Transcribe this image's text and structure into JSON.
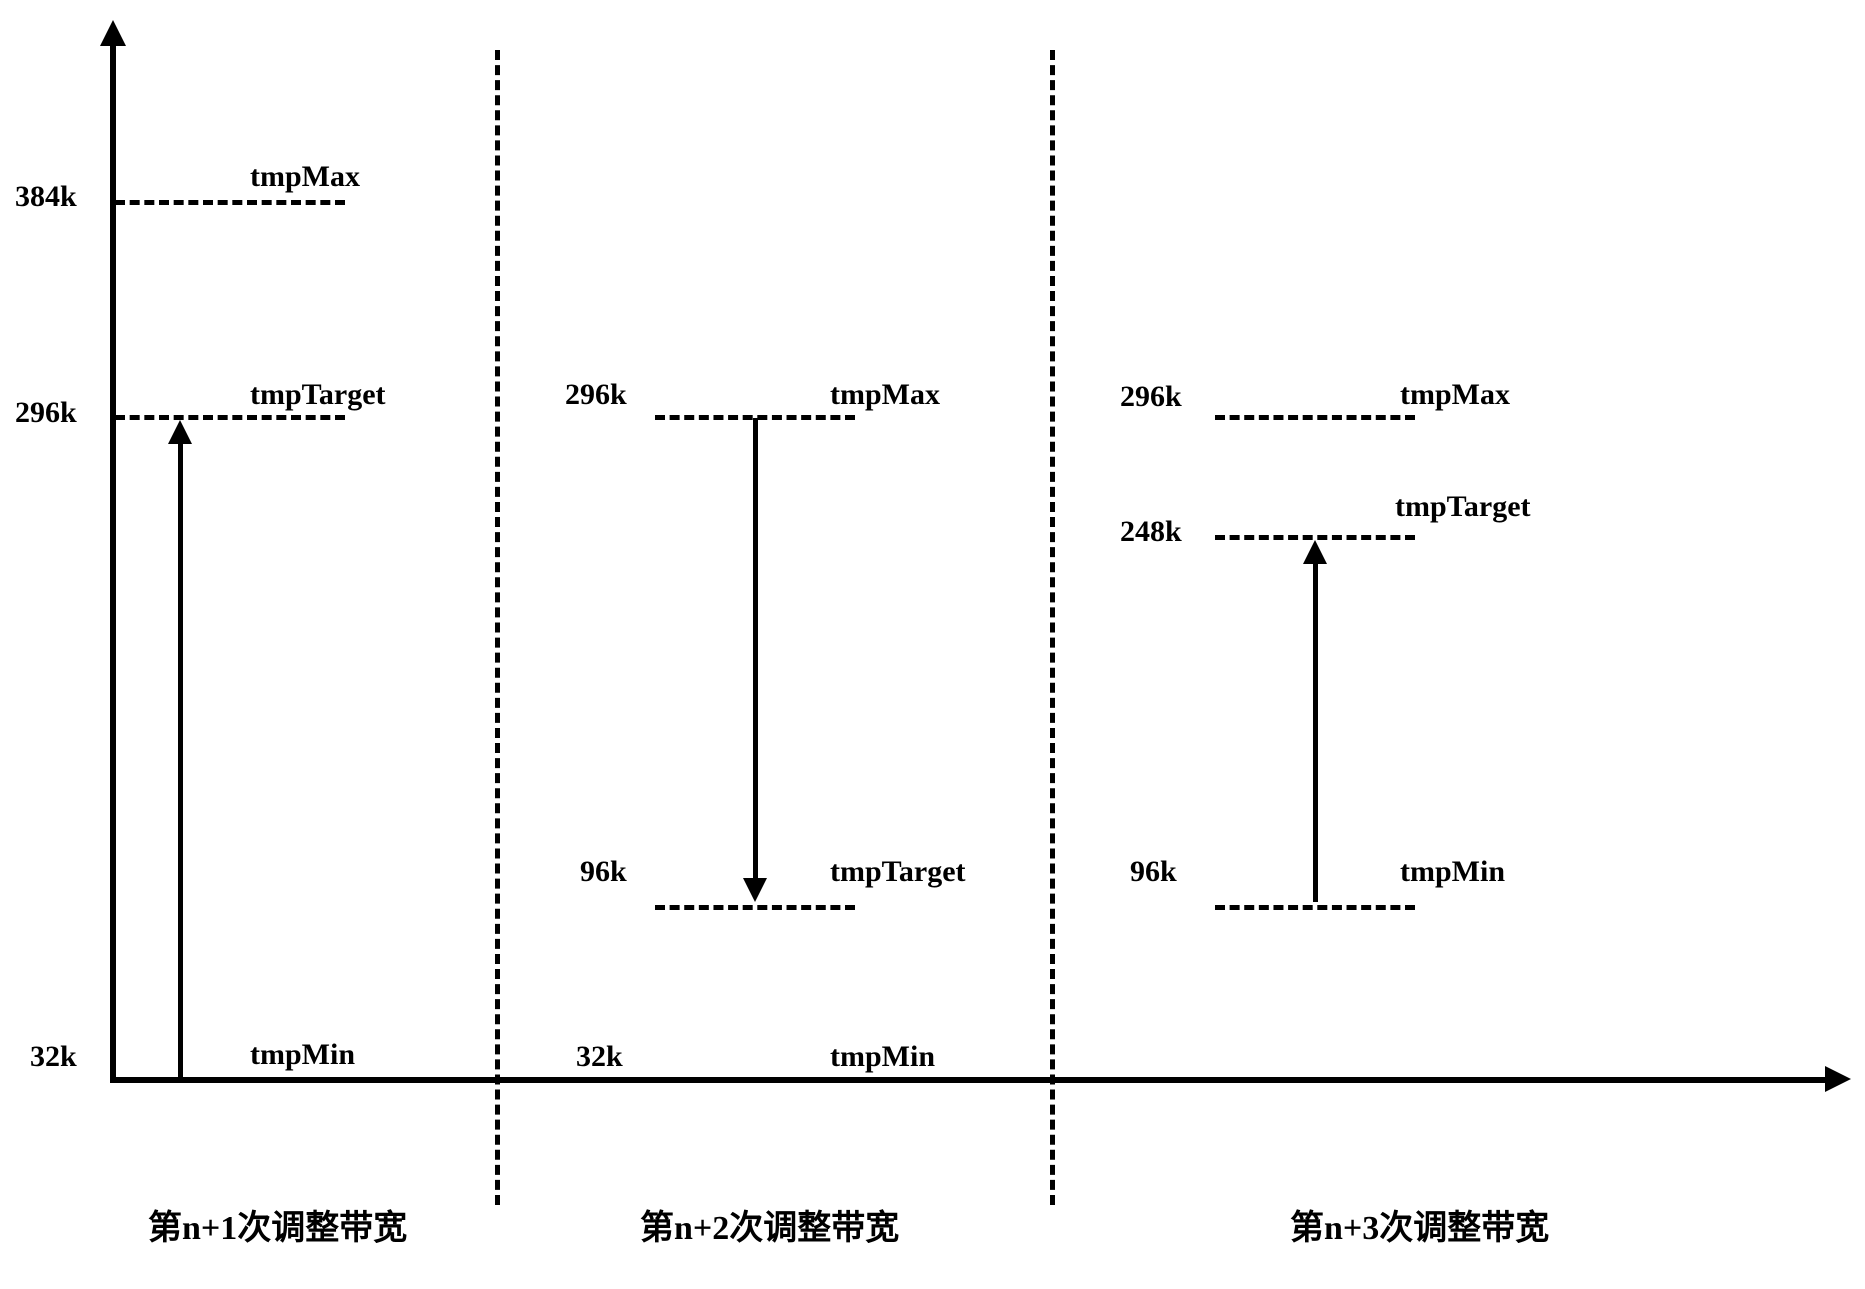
{
  "chart_data": {
    "type": "line",
    "title": "",
    "xlabel": "",
    "ylabel": "",
    "series": [
      {
        "name": "第n+1次调整带宽",
        "tmpMin": 32,
        "tmpTarget": 296,
        "tmpMax": 384,
        "direction": "up"
      },
      {
        "name": "第n+2次调整带宽",
        "tmpMin": 32,
        "tmpTarget": 96,
        "tmpMax": 296,
        "direction": "down"
      },
      {
        "name": "第n+3次调整带宽",
        "tmpMin": 96,
        "tmpTarget": 248,
        "tmpMax": 296,
        "direction": "up"
      }
    ],
    "ylim": [
      32,
      384
    ],
    "unit": "k"
  },
  "labels": {
    "y384": "384k",
    "y296": "296k",
    "y32": "32k",
    "p1_tmpMax": "tmpMax",
    "p1_tmpTarget": "tmpTarget",
    "p1_tmpMin": "tmpMin",
    "p2_296": "296k",
    "p2_96": "96k",
    "p2_32": "32k",
    "p2_tmpMax": "tmpMax",
    "p2_tmpTarget": "tmpTarget",
    "p2_tmpMin": "tmpMin",
    "p3_296": "296k",
    "p3_248": "248k",
    "p3_96": "96k",
    "p3_tmpMax": "tmpMax",
    "p3_tmpTarget": "tmpTarget",
    "p3_tmpMin": "tmpMin",
    "cap1": "第n+1次调整带宽",
    "cap2": "第n+2次调整带宽",
    "cap3": "第n+3次调整带宽"
  }
}
